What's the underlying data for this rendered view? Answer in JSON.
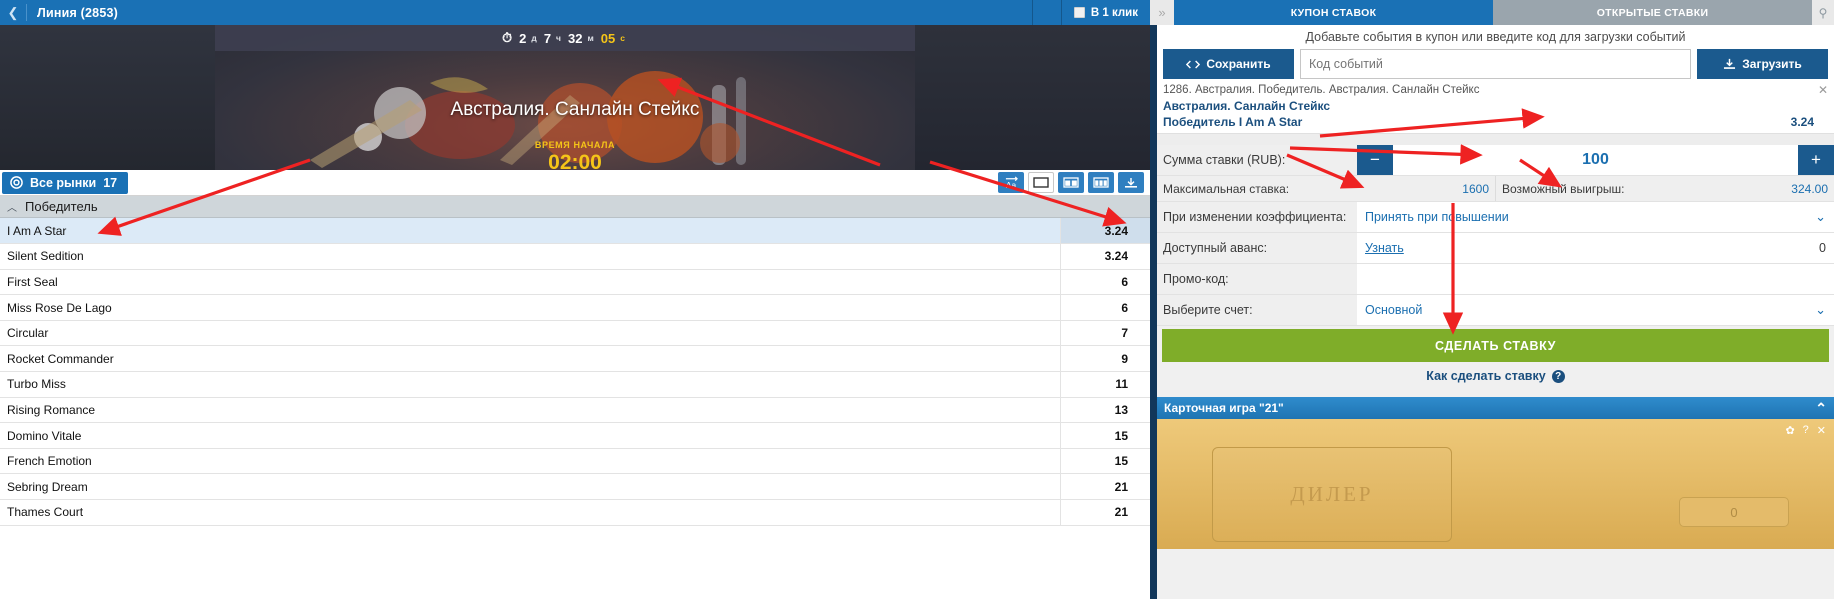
{
  "topbar": {
    "back_icon": "chevron-left-icon",
    "title": "Линия (2853)",
    "oneclick_label": "В 1 клик"
  },
  "banner": {
    "timer": {
      "icon": "stopwatch-icon",
      "days": "2",
      "days_unit": "д",
      "hours": "7",
      "hours_unit": "ч",
      "minutes": "32",
      "minutes_unit": "м",
      "seconds": "05",
      "seconds_unit": "с"
    },
    "event_title": "Австралия. Санлайн Стейкс",
    "start_label": "ВРЕМЯ НАЧАЛА",
    "start_time": "02:00"
  },
  "markets": {
    "all_markets_label": "Все рынки",
    "all_markets_count": "17",
    "group_title": "Победитель",
    "view_icons": [
      "text-size-icon",
      "single-column-icon",
      "two-column-icon",
      "three-column-icon",
      "collapse-icon"
    ],
    "rows": [
      {
        "name": "I Am A Star",
        "odd": "3.24",
        "selected": true
      },
      {
        "name": "Silent Sedition",
        "odd": "3.24",
        "selected": false
      },
      {
        "name": "First Seal",
        "odd": "6",
        "selected": false
      },
      {
        "name": "Miss Rose De Lago",
        "odd": "6",
        "selected": false
      },
      {
        "name": "Circular",
        "odd": "7",
        "selected": false
      },
      {
        "name": "Rocket Commander",
        "odd": "9",
        "selected": false
      },
      {
        "name": "Turbo Miss",
        "odd": "11",
        "selected": false
      },
      {
        "name": "Rising Romance",
        "odd": "13",
        "selected": false
      },
      {
        "name": "Domino Vitale",
        "odd": "15",
        "selected": false
      },
      {
        "name": "French Emotion",
        "odd": "15",
        "selected": false
      },
      {
        "name": "Sebring Dream",
        "odd": "21",
        "selected": false
      },
      {
        "name": "Thames Court",
        "odd": "21",
        "selected": false
      }
    ]
  },
  "betslip": {
    "collapse_icon": "chevron-right-icon",
    "pin_icon": "pin-icon",
    "tab_active": "КУПОН СТАВОК",
    "tab_inactive": "ОТКРЫТЫЕ СТАВКИ",
    "hint": "Добавьте события в купон или введите код для загрузки событий",
    "save_label": "Сохранить",
    "save_icon": "code-icon",
    "load_label": "Загрузить",
    "load_icon": "download-icon",
    "code_placeholder": "Код событий",
    "code_value": "",
    "event": {
      "path": "1286. Австралия. Победитель. Австралия. Санлайн Стейкс",
      "name": "Австралия. Санлайн Стейкс",
      "pick": "Победитель I Am A Star",
      "odd": "3.24",
      "remove_icon": "close-icon"
    },
    "stake_label": "Сумма ставки (RUB):",
    "stake_value": "100",
    "minus_label": "−",
    "plus_label": "+",
    "max_stake_label": "Максимальная ставка:",
    "max_stake_value": "1600",
    "possible_win_label": "Возможный выигрыш:",
    "possible_win_value": "324.00",
    "odd_change_label": "При изменении коэффициента:",
    "odd_change_value": "Принять при повышении",
    "advance_label": "Доступный аванс:",
    "advance_link": "Узнать",
    "advance_value": "0",
    "promo_label": "Промо-код:",
    "promo_value": "",
    "account_label": "Выберите счет:",
    "account_value": "Основной",
    "place_bet_label": "СДЕЛАТЬ СТАВКУ",
    "howto_label": "Как сделать ставку",
    "howto_icon": "question-icon"
  },
  "card_game": {
    "title": "Карточная игра \"21\"",
    "collapse_icon": "chevrons-up-icon",
    "tools": [
      "gear-icon",
      "question-icon",
      "fullscreen-icon"
    ],
    "dealer_label": "ДИЛЕР",
    "score": "0"
  },
  "colors": {
    "brand_blue": "#1a71b5",
    "dark_blue": "#1b5a8e",
    "green": "#7fad29",
    "gold": "#f5c518",
    "arrow_red": "#ee2222"
  }
}
